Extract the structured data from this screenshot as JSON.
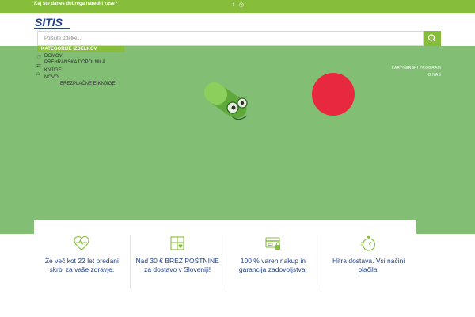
{
  "topbar": {
    "tagline": "Kaj ste danes dobrega naredili zase?",
    "social": [
      "f",
      "◎"
    ]
  },
  "logo": {
    "text": "SITIS"
  },
  "search": {
    "placeholder": "Poiščite izdelke ..."
  },
  "nav": {
    "categories_label": "KATEGORIJE IZDELKOV",
    "items": [
      "DOMOV",
      "PREHRANSKA DOPOLNILA",
      "KNJIGE",
      "NOVO",
      "BREZPLAČNE E-KNJIGE"
    ],
    "right_links": [
      "PARTNERSKI PROGRAM",
      "O NAS"
    ]
  },
  "features": [
    {
      "icon": "heart-pulse-icon",
      "text": "Že več kot 22 let predani skrbi za vaše zdravje."
    },
    {
      "icon": "box-heart-icon",
      "text": "Nad 30 € BREZ POŠTNINE za dostavo v Sloveniji!"
    },
    {
      "icon": "secure-card-icon",
      "text": "100 % varen nakup in garancija zadovoljstva."
    },
    {
      "icon": "stopwatch-icon",
      "text": "Hitra dostava. Vsi načini plačila."
    }
  ],
  "colors": {
    "brand_green": "#86bd3a",
    "hero_green": "#82bf75",
    "accent_red": "#e7283f",
    "text_blue": "#24438a"
  }
}
